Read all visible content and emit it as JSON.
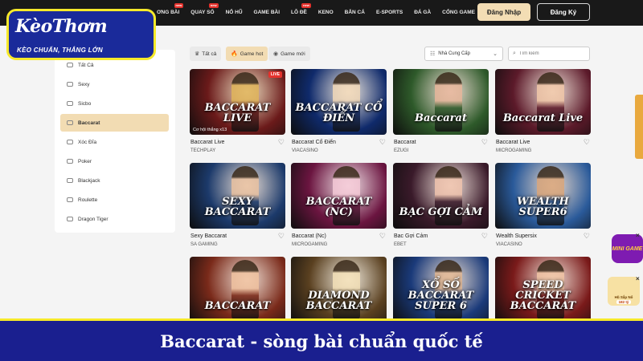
{
  "logo": {
    "brand_main": "KèoThơm",
    "brand_tag": "KÈO CHUẨN, THẮNG LỚN"
  },
  "header": {
    "nav": [
      {
        "label": "ƠNG BÀI",
        "badge": "new"
      },
      {
        "label": "QUAY SỐ",
        "badge": "new"
      },
      {
        "label": "NỔ HŨ",
        "badge": ""
      },
      {
        "label": "GAME BÀI",
        "badge": ""
      },
      {
        "label": "LÔ ĐỀ",
        "badge": "new"
      },
      {
        "label": "KENO",
        "badge": ""
      },
      {
        "label": "BẮN CÁ",
        "badge": ""
      },
      {
        "label": "E-SPORTS",
        "badge": ""
      },
      {
        "label": "ĐÁ GÀ",
        "badge": ""
      },
      {
        "label": "CỔNG GAME",
        "badge": ""
      },
      {
        "label": "KHUYẾN MÃI",
        "badge": ""
      }
    ],
    "login_label": "Đăng Nhập",
    "register_label": "Đăng Ký"
  },
  "sidebar": {
    "items": [
      {
        "label": "Tất Cả",
        "active": false
      },
      {
        "label": "Sexy",
        "active": false
      },
      {
        "label": "Sicbo",
        "active": false
      },
      {
        "label": "Baccarat",
        "active": true
      },
      {
        "label": "Xóc Đĩa",
        "active": false
      },
      {
        "label": "Poker",
        "active": false
      },
      {
        "label": "Blackjack",
        "active": false
      },
      {
        "label": "Roulette",
        "active": false
      },
      {
        "label": "Dragon Tiger",
        "active": false
      }
    ]
  },
  "filters": {
    "chips": [
      {
        "label": "Tất cả",
        "icon": "crown-icon",
        "active": false
      },
      {
        "label": "Game hot",
        "icon": "fire-icon",
        "active": true
      },
      {
        "label": "Game mới",
        "icon": "new-icon",
        "active": false
      }
    ],
    "provider_select": "Nhà Cung Cấp",
    "search_placeholder": "Tìm kiếm"
  },
  "games": [
    {
      "name": "Baccarat Live",
      "provider": "TECHPLAY",
      "title_art": "BACCARAT LIVE",
      "live": "LIVE",
      "caption": "Cơ hội thắng x13",
      "bg": "#6b1a1a",
      "accent": "#e0b45a"
    },
    {
      "name": "Baccarat Cổ Điển",
      "provider": "VIACASINO",
      "title_art": "BACCARAT CỔ ĐIỂN",
      "live": "",
      "caption": "",
      "bg": "#0f2a6b",
      "accent": "#f1d8b8"
    },
    {
      "name": "Baccarat",
      "provider": "EZUGI",
      "title_art": "Baccarat",
      "live": "",
      "caption": "",
      "bg": "#2e5a2a",
      "accent": "#e6b59a"
    },
    {
      "name": "Baccarat Live",
      "provider": "MICROGAMING",
      "title_art": "Baccarat Live",
      "live": "",
      "caption": "",
      "bg": "#5c1a2a",
      "accent": "#f0c7a8"
    },
    {
      "name": "Sexy Baccarat",
      "provider": "SA GAMING",
      "title_art": "SEXY BACCARAT",
      "live": "",
      "caption": "",
      "bg": "#1c3a6b",
      "accent": "#e9c1a0"
    },
    {
      "name": "Baccarat (Nc)",
      "provider": "MICROGAMING",
      "title_art": "BACCARAT (NC)",
      "live": "",
      "caption": "",
      "bg": "#6b1540",
      "accent": "#f4c9d6"
    },
    {
      "name": "Bac Gợi Cảm",
      "provider": "EBET",
      "title_art": "BẠC GỢI CẢM",
      "live": "",
      "caption": "",
      "bg": "#3a1a2a",
      "accent": "#efc3ad"
    },
    {
      "name": "Wealth Supersix",
      "provider": "VIACASINO",
      "title_art": "WEALTH SUPER6",
      "live": "",
      "caption": "",
      "bg": "#2a5a9a",
      "accent": "#d9a57a"
    },
    {
      "name": "",
      "provider": "",
      "title_art": "BACCARAT",
      "live": "",
      "caption": "",
      "bg": "#7a2a1a",
      "accent": "#f0c2a0"
    },
    {
      "name": "",
      "provider": "",
      "title_art": "DIAMOND BACCARAT",
      "live": "",
      "caption": "",
      "bg": "#5a4020",
      "accent": "#f3e0b8"
    },
    {
      "name": "",
      "provider": "",
      "title_art": "XỔ SỐ BACCARAT SUPER 6",
      "live": "",
      "caption": "",
      "bg": "#1a3a7a",
      "accent": "#e2b894"
    },
    {
      "name": "",
      "provider": "",
      "title_art": "SPEED CRICKET BACCARAT",
      "live": "",
      "caption": "",
      "bg": "#7a1a1a",
      "accent": "#f0c4a4"
    }
  ],
  "widgets": {
    "mini_game_label": "MINI GAME",
    "jackpot_label": "Hũ Sắp Nổ",
    "jackpot_amount": "182 tỷ"
  },
  "banner": {
    "text": "Baccarat - sòng bài chuẩn quốc tế"
  },
  "colors": {
    "header_bg": "#191919",
    "accent_gold": "#f2dcb3",
    "banner_bg": "#1a1f8f",
    "banner_border": "#f6e92a"
  }
}
